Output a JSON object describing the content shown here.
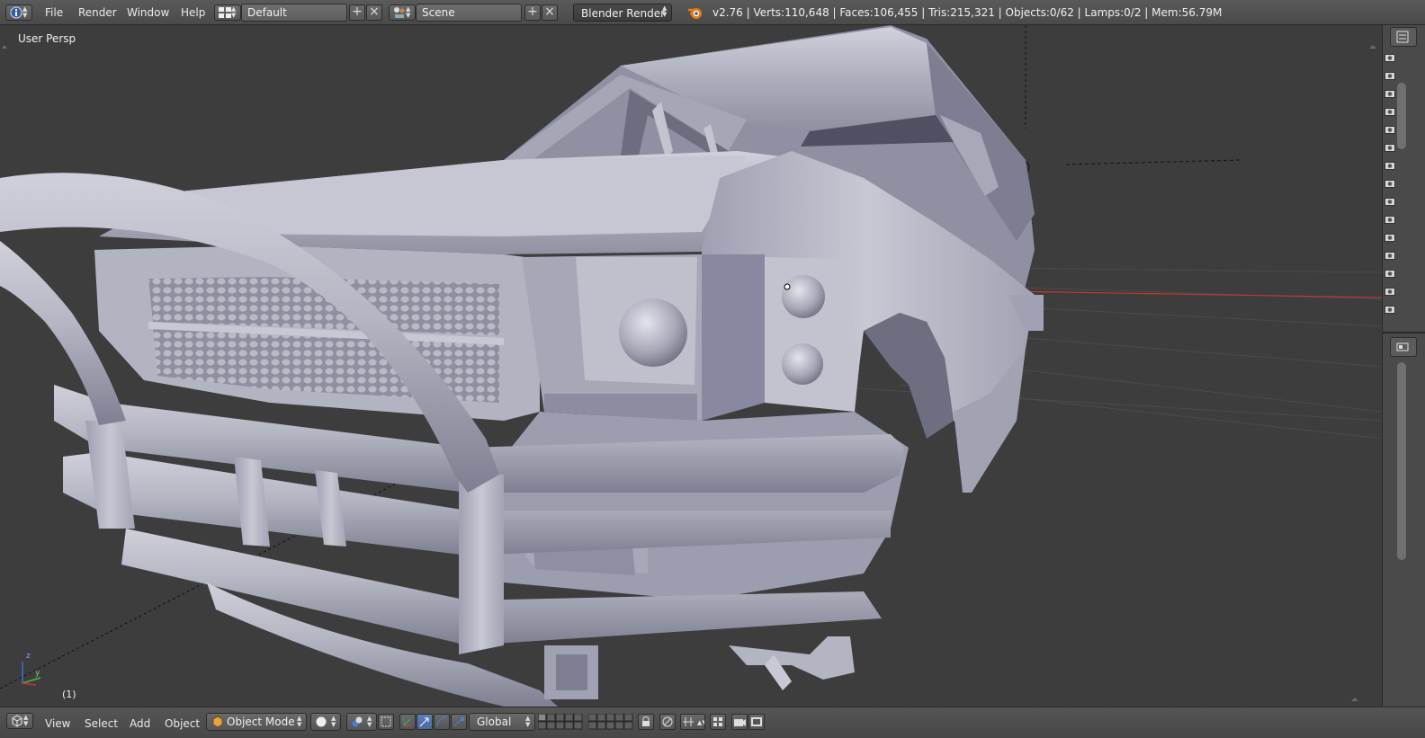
{
  "header": {
    "editor_icon": "info-icon",
    "menus": [
      "File",
      "Render",
      "Window",
      "Help"
    ],
    "screen_layout": "Default",
    "scene": "Scene",
    "render_engine": "Blender Render",
    "stats": "v2.76 | Verts:110,648 | Faces:106,455 | Tris:215,321 | Objects:0/62 | Lamps:0/2 | Mem:56.79M"
  },
  "viewport": {
    "view_label": "User Persp",
    "frame_label": "(1)",
    "axis_labels": {
      "z": "z",
      "y": "y"
    },
    "colors": {
      "background": "#3d3d3d",
      "model": "#b7b8c4",
      "x_axis": "#c0392b",
      "grid": "#4a4a4a"
    }
  },
  "footer": {
    "editor_icon": "view3d-icon",
    "menus": [
      "View",
      "Select",
      "Add",
      "Object"
    ],
    "mode": "Object Mode",
    "pivot_icon": "pivot-icon",
    "orientation": "Global"
  }
}
